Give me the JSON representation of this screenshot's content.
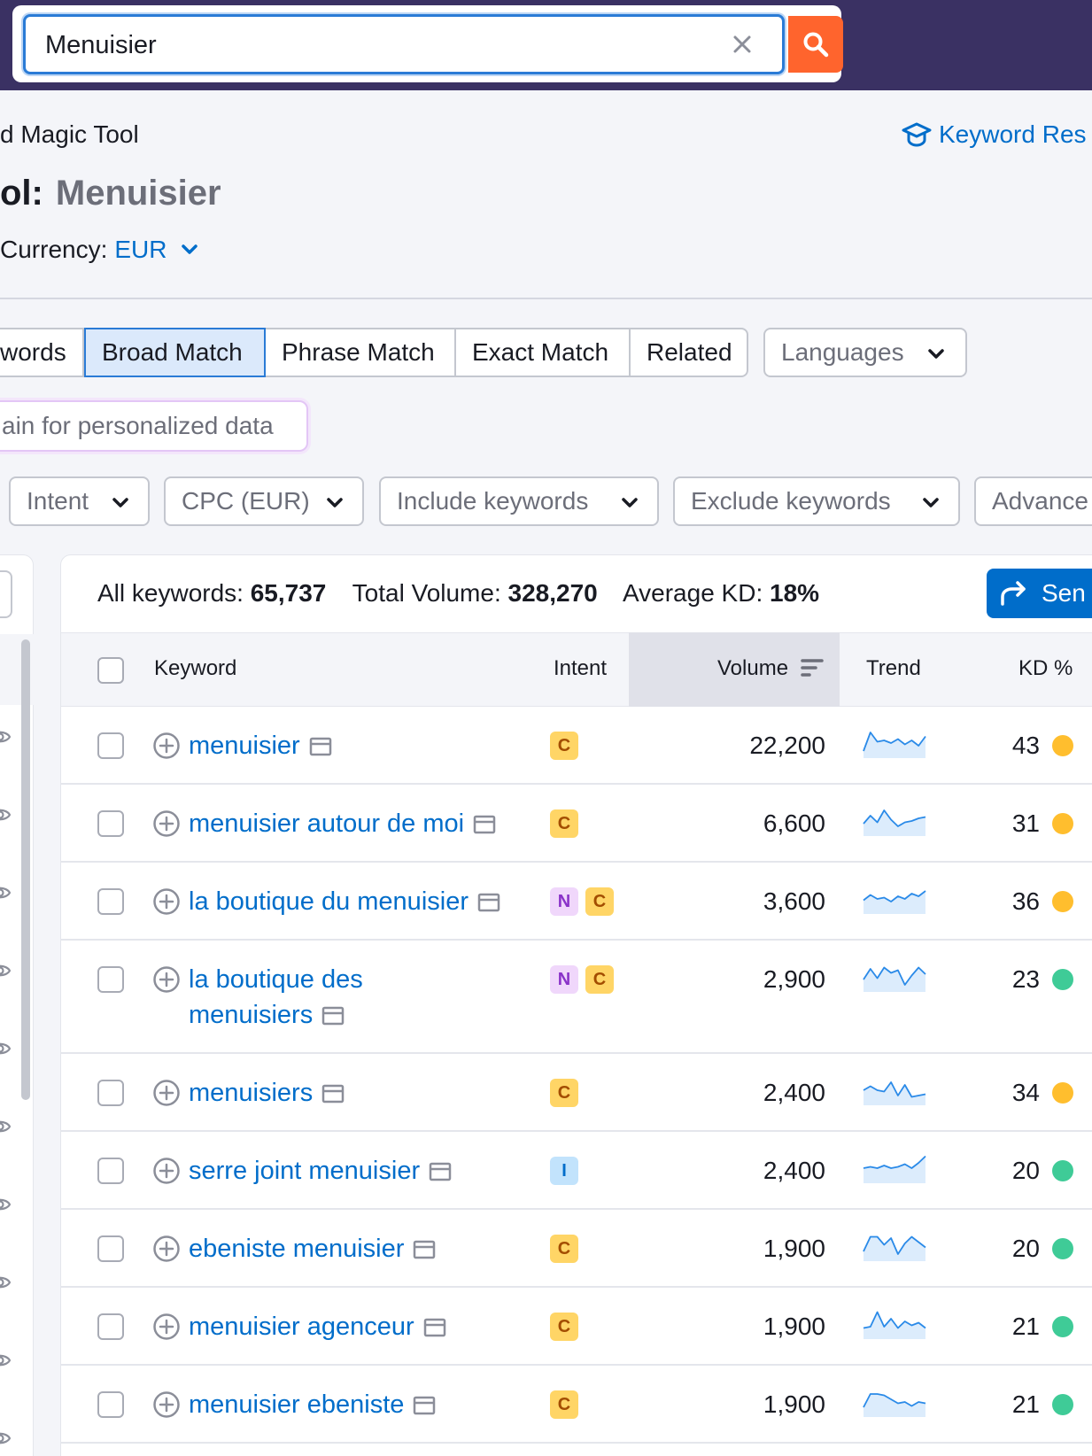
{
  "search": {
    "value": "Menuisier"
  },
  "header": {
    "breadcrumb": "d Magic Tool",
    "kr_link": "Keyword Res",
    "title_prefix": "ol:",
    "title_query": "Menuisier",
    "currency_label": "Currency:",
    "currency_value": "EUR"
  },
  "tabs": [
    {
      "label": "words",
      "active": false
    },
    {
      "label": "Broad Match",
      "active": true
    },
    {
      "label": "Phrase Match",
      "active": false
    },
    {
      "label": "Exact Match",
      "active": false
    },
    {
      "label": "Related",
      "active": false
    }
  ],
  "languages": "Languages",
  "domain_hint": "ain for personalized data",
  "filters": [
    "Intent",
    "CPC (EUR)",
    "Include keywords",
    "Exclude keywords",
    "Advance"
  ],
  "summary": {
    "all_keywords_label": "All keywords:",
    "all_keywords": "65,737",
    "total_volume_label": "Total Volume:",
    "total_volume": "328,270",
    "avg_kd_label": "Average KD:",
    "avg_kd": "18%"
  },
  "send_button": "Sen",
  "columns": {
    "keyword": "Keyword",
    "intent": "Intent",
    "volume": "Volume",
    "trend": "Trend",
    "kd": "KD %"
  },
  "colors": {
    "accent": "#006dca",
    "orange": "#ff642d",
    "kd_yellow": "#ffbe2e",
    "kd_green": "#3fcb97",
    "topbar": "#3a3163"
  },
  "rows": [
    {
      "keyword": "menuisier",
      "keyword2": "",
      "intents": [
        "C"
      ],
      "volume": "22,200",
      "kd": "43",
      "kd_color": "yellow",
      "trend": [
        0.2,
        0.9,
        0.55,
        0.6,
        0.5,
        0.65,
        0.45,
        0.6,
        0.4,
        0.75
      ]
    },
    {
      "keyword": "menuisier autour de moi",
      "keyword2": "",
      "intents": [
        "C"
      ],
      "volume": "6,600",
      "kd": "31",
      "kd_color": "yellow",
      "trend": [
        0.4,
        0.7,
        0.45,
        0.9,
        0.55,
        0.3,
        0.45,
        0.5,
        0.6,
        0.65
      ]
    },
    {
      "keyword": "la boutique du menuisier",
      "keyword2": "",
      "intents": [
        "N",
        "C"
      ],
      "volume": "3,600",
      "kd": "36",
      "kd_color": "yellow",
      "trend": [
        0.45,
        0.65,
        0.5,
        0.55,
        0.4,
        0.6,
        0.5,
        0.7,
        0.6,
        0.8
      ]
    },
    {
      "keyword": "la boutique des",
      "keyword2": "menuisiers",
      "intents": [
        "N",
        "C"
      ],
      "volume": "2,900",
      "kd": "23",
      "kd_color": "green",
      "trend": [
        0.4,
        0.8,
        0.45,
        0.85,
        0.65,
        0.75,
        0.2,
        0.55,
        0.85,
        0.6
      ]
    },
    {
      "keyword": "menuisiers",
      "keyword2": "",
      "intents": [
        "C"
      ],
      "volume": "2,400",
      "kd": "34",
      "kd_color": "yellow",
      "trend": [
        0.5,
        0.65,
        0.5,
        0.45,
        0.8,
        0.3,
        0.7,
        0.25,
        0.3,
        0.35
      ]
    },
    {
      "keyword": "serre joint menuisier",
      "keyword2": "",
      "intents": [
        "I"
      ],
      "volume": "2,400",
      "kd": "20",
      "kd_color": "green",
      "trend": [
        0.5,
        0.55,
        0.5,
        0.6,
        0.5,
        0.55,
        0.65,
        0.5,
        0.7,
        0.95
      ]
    },
    {
      "keyword": "ebeniste menuisier",
      "keyword2": "",
      "intents": [
        "C"
      ],
      "volume": "1,900",
      "kd": "20",
      "kd_color": "green",
      "trend": [
        0.3,
        0.85,
        0.85,
        0.55,
        0.8,
        0.2,
        0.6,
        0.85,
        0.65,
        0.45
      ]
    },
    {
      "keyword": "menuisier agenceur",
      "keyword2": "",
      "intents": [
        "C"
      ],
      "volume": "1,900",
      "kd": "21",
      "kd_color": "green",
      "trend": [
        0.35,
        0.4,
        0.95,
        0.4,
        0.7,
        0.35,
        0.6,
        0.45,
        0.55,
        0.35
      ]
    },
    {
      "keyword": "menuisier ebeniste",
      "keyword2": "",
      "intents": [
        "C"
      ],
      "volume": "1,900",
      "kd": "21",
      "kd_color": "green",
      "trend": [
        0.3,
        0.8,
        0.8,
        0.75,
        0.6,
        0.45,
        0.5,
        0.35,
        0.5,
        0.45
      ]
    }
  ]
}
